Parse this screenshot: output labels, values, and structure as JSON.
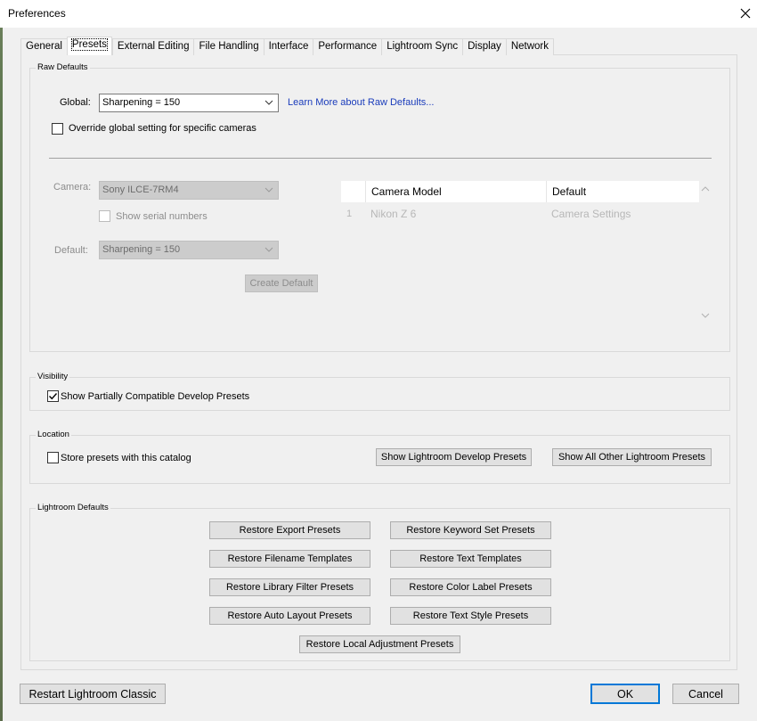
{
  "window": {
    "title": "Preferences",
    "close_icon": "close-icon"
  },
  "tabs": [
    {
      "label": "General",
      "active": false
    },
    {
      "label": "Presets",
      "active": true
    },
    {
      "label": "External Editing",
      "active": false
    },
    {
      "label": "File Handling",
      "active": false
    },
    {
      "label": "Interface",
      "active": false
    },
    {
      "label": "Performance",
      "active": false
    },
    {
      "label": "Lightroom Sync",
      "active": false
    },
    {
      "label": "Display",
      "active": false
    },
    {
      "label": "Network",
      "active": false
    }
  ],
  "raw_defaults": {
    "group_label": "Raw Defaults",
    "global_label": "Global:",
    "global_value": "Sharpening = 150",
    "learn_more": "Learn More about Raw Defaults...",
    "override_label": "Override global setting for specific cameras",
    "override_checked": false,
    "camera_label": "Camera:",
    "camera_value": "Sony ILCE-7RM4",
    "serial_label": "Show serial numbers",
    "default_label": "Default:",
    "default_value": "Sharpening = 150",
    "create_default": "Create Default",
    "table": {
      "col_model": "Camera Model",
      "col_default": "Default",
      "rows": [
        {
          "index": "1",
          "model": "Nikon Z 6",
          "default": "Camera Settings"
        }
      ]
    }
  },
  "visibility": {
    "group_label": "Visibility",
    "show_partial_label": "Show Partially Compatible Develop Presets",
    "show_partial_checked": true
  },
  "location": {
    "group_label": "Location",
    "store_label": "Store presets with this catalog",
    "store_checked": false,
    "show_develop": "Show Lightroom Develop Presets",
    "show_other": "Show All Other Lightroom Presets"
  },
  "lightroom_defaults": {
    "group_label": "Lightroom Defaults",
    "buttons": [
      "Restore Export Presets",
      "Restore Keyword Set Presets",
      "Restore Filename Templates",
      "Restore Text Templates",
      "Restore Library Filter Presets",
      "Restore Color Label Presets",
      "Restore Auto Layout Presets",
      "Restore Text Style Presets",
      "Restore Local Adjustment Presets"
    ]
  },
  "footer": {
    "restart": "Restart Lightroom Classic",
    "ok": "OK",
    "cancel": "Cancel"
  },
  "colors": {
    "link": "#1a3cbb",
    "ok_border": "#0078d7"
  }
}
